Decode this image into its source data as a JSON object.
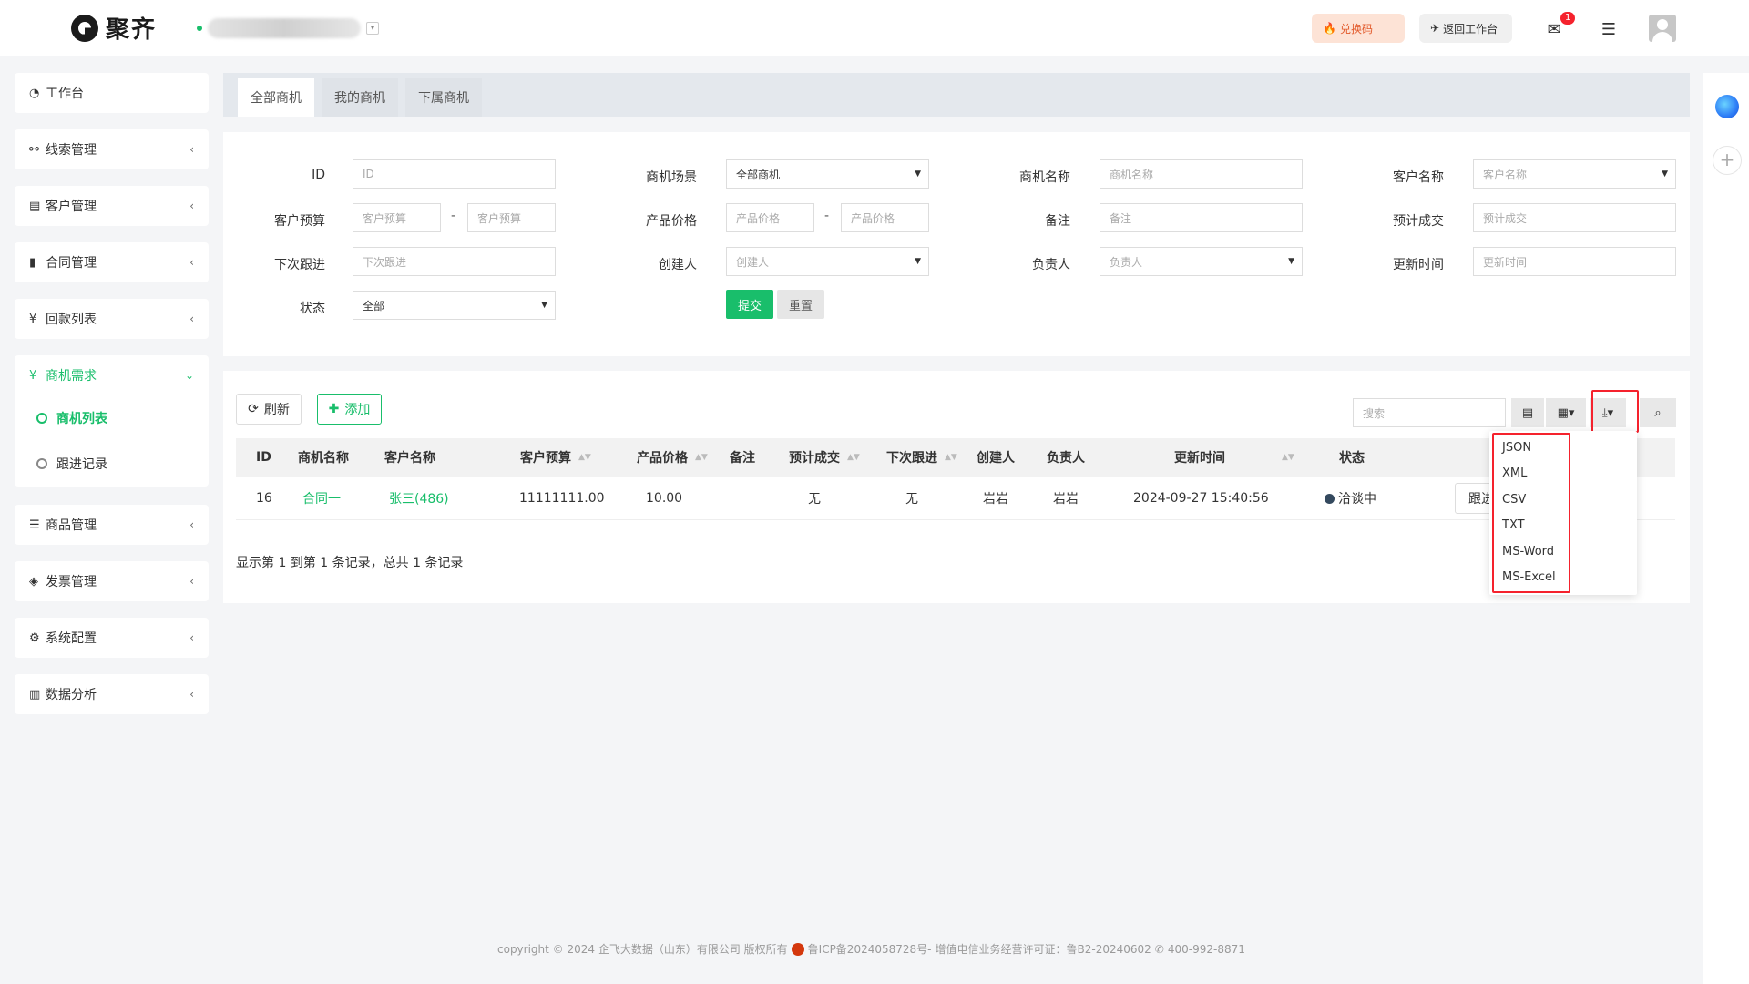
{
  "header": {
    "logo_text": "聚齐",
    "redeem_label": "兑换码",
    "back_label": "返回工作台",
    "mail_badge": "1"
  },
  "sidebar": {
    "items": [
      {
        "label": "工作台",
        "icon": "dashboard-icon"
      },
      {
        "label": "线索管理",
        "icon": "link-icon"
      },
      {
        "label": "客户管理",
        "icon": "id-card-icon"
      },
      {
        "label": "合同管理",
        "icon": "bookmark-icon"
      },
      {
        "label": "回款列表",
        "icon": "yen-icon"
      },
      {
        "label": "商机需求",
        "icon": "yen-icon"
      },
      {
        "label": "商品管理",
        "icon": "list-icon"
      },
      {
        "label": "发票管理",
        "icon": "tag-icon"
      },
      {
        "label": "系统配置",
        "icon": "gears-icon"
      },
      {
        "label": "数据分析",
        "icon": "bar-chart-icon"
      }
    ],
    "sub_items": [
      {
        "label": "商机列表"
      },
      {
        "label": "跟进记录"
      }
    ]
  },
  "tabs": [
    {
      "label": "全部商机"
    },
    {
      "label": "我的商机"
    },
    {
      "label": "下属商机"
    }
  ],
  "filter": {
    "labels": {
      "id": "ID",
      "scene": "商机场景",
      "name": "商机名称",
      "customer": "客户名称",
      "budget": "客户预算",
      "price": "产品价格",
      "remark": "备注",
      "deal": "预计成交",
      "next": "下次跟进",
      "creator": "创建人",
      "owner": "负责人",
      "updated": "更新时间",
      "status": "状态"
    },
    "placeholders": {
      "id": "ID",
      "name": "商机名称",
      "customer": "客户名称",
      "budget_min": "客户预算",
      "budget_max": "客户预算",
      "price_min": "产品价格",
      "price_max": "产品价格",
      "remark": "备注",
      "deal": "预计成交",
      "next": "下次跟进",
      "creator": "创建人",
      "owner": "负责人",
      "updated": "更新时间"
    },
    "scene_value": "全部商机",
    "status_value": "全部",
    "dash": "-",
    "submit_label": "提交",
    "reset_label": "重置"
  },
  "toolbar": {
    "refresh_label": "刷新",
    "add_label": "添加",
    "search_placeholder": "搜索"
  },
  "table": {
    "headers": [
      "ID",
      "商机名称",
      "客户名称",
      "客户预算",
      "产品价格",
      "备注",
      "预计成交",
      "下次跟进",
      "创建人",
      "负责人",
      "更新时间",
      "状态"
    ],
    "rows": [
      {
        "id": "16",
        "name": "合同一",
        "customer": "张三(486)",
        "budget": "11111111.00",
        "price": "10.00",
        "remark": "",
        "deal": "无",
        "next": "无",
        "creator": "岩岩",
        "owner": "岩岩",
        "updated": "2024-09-27 15:40:56",
        "status": "洽谈中",
        "action": "跟进"
      }
    ],
    "pager_info": "显示第 1 到第 1 条记录，总共 1 条记录"
  },
  "export_menu": [
    "JSON",
    "XML",
    "CSV",
    "TXT",
    "MS-Word",
    "MS-Excel"
  ],
  "footer": {
    "copyright": "copyright © 2024 企飞大数据（山东）有限公司 版权所有",
    "icp": "鲁ICP备2024058728号-",
    "license": "增值电信业务经营许可证：鲁B2-20240602",
    "phone": "400-992-8871"
  },
  "colors": {
    "accent": "#19be6b",
    "highlight": "#f5222d"
  }
}
